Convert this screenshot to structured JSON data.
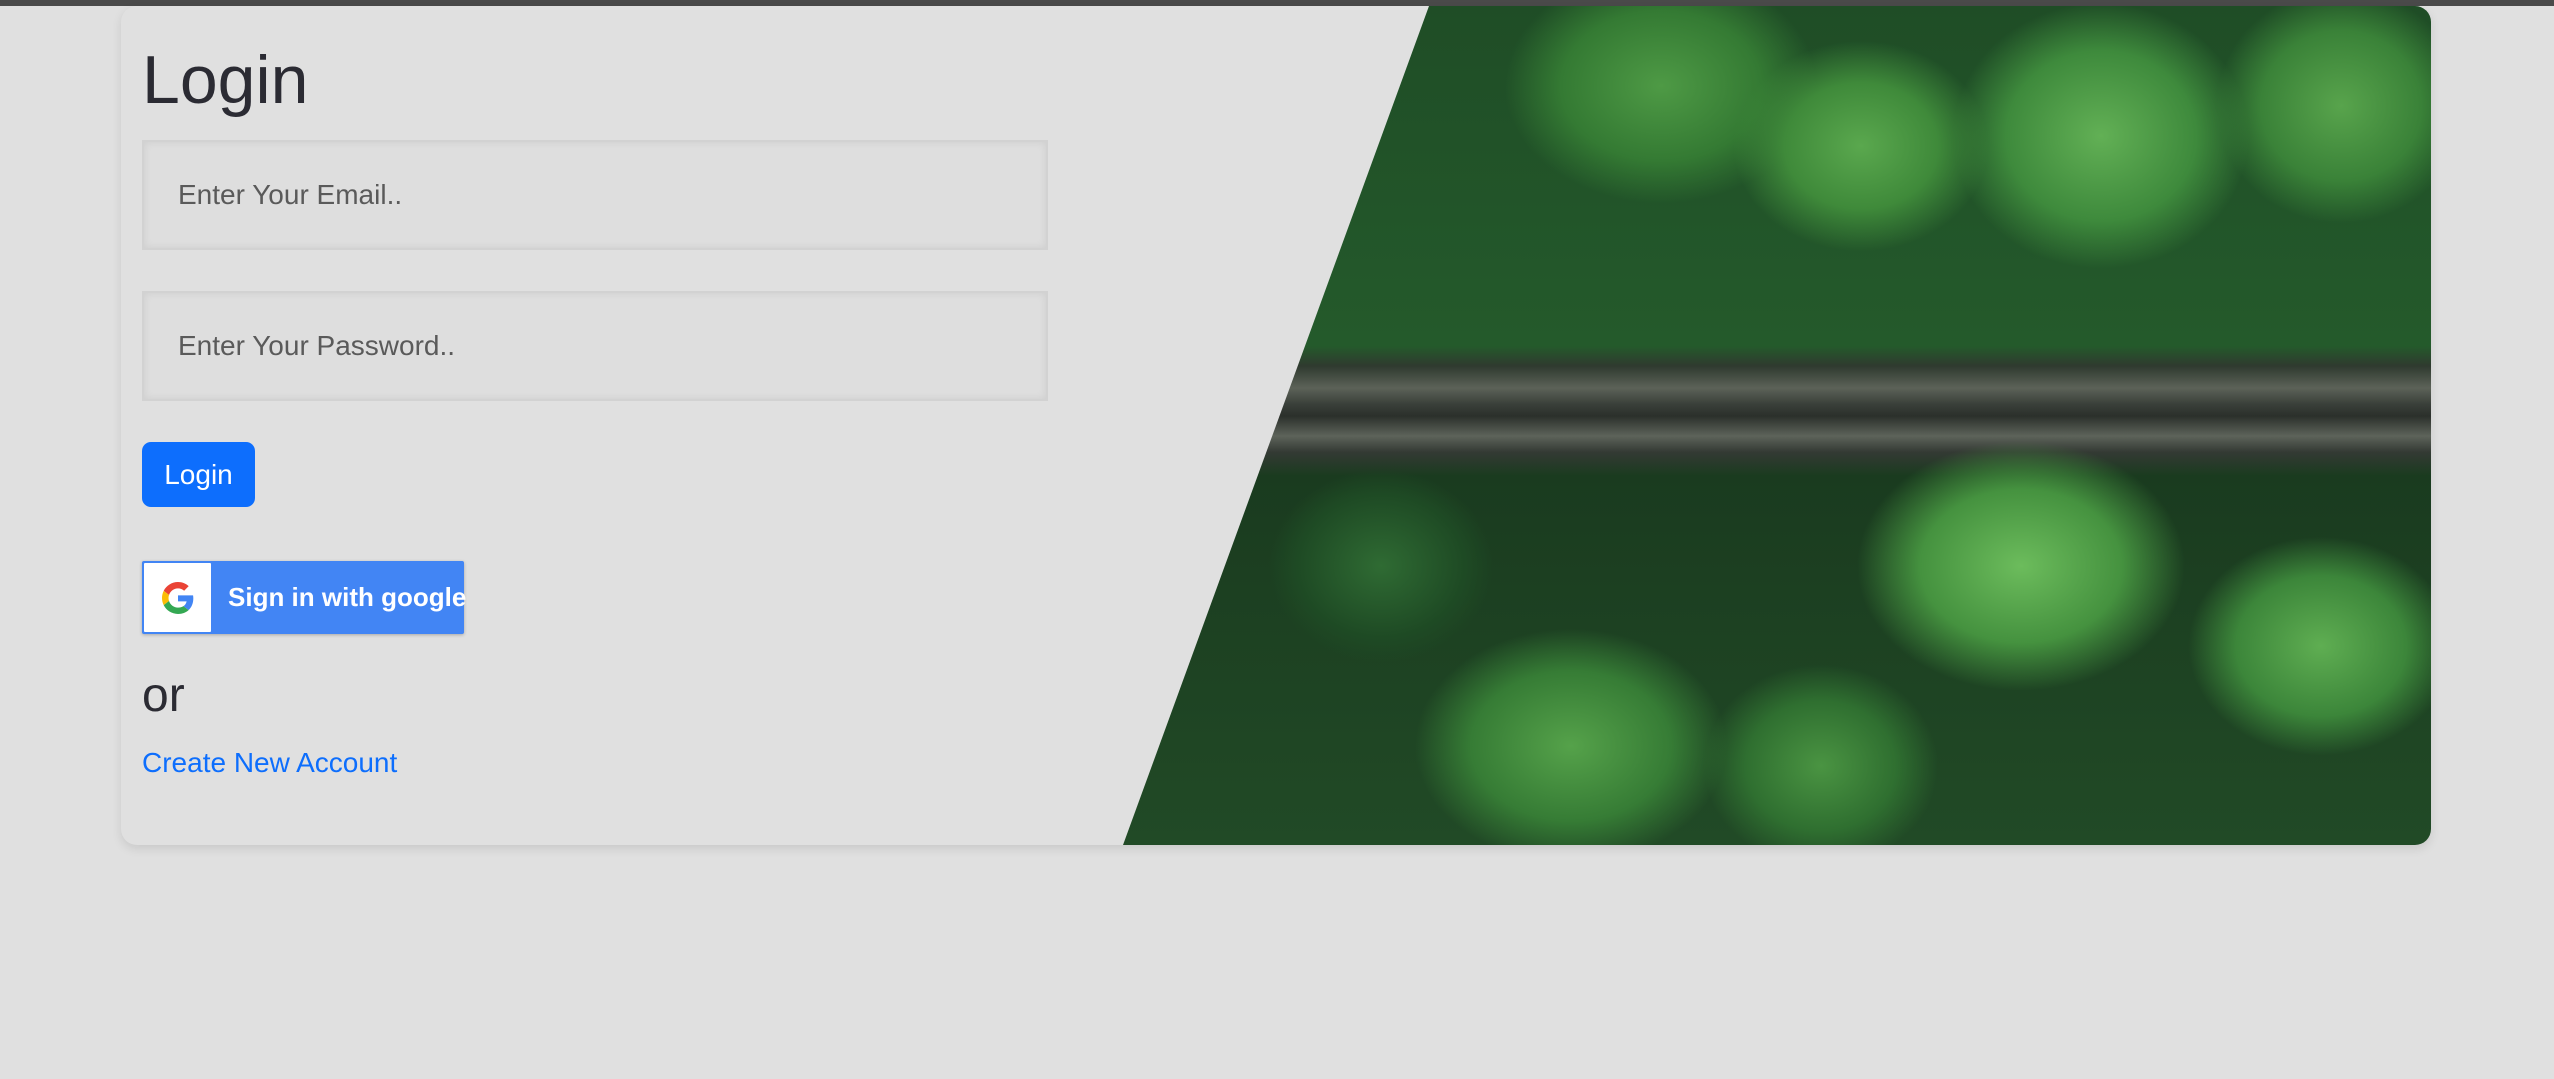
{
  "login": {
    "title": "Login",
    "email_placeholder": "Enter Your Email..",
    "password_placeholder": "Enter Your Password..",
    "login_button_label": "Login",
    "google_button_label": "Sign in with google",
    "or_text": "or",
    "create_account_link": "Create New Account"
  },
  "image": {
    "description_icon": "forest-road-aerial-photo"
  },
  "colors": {
    "primary": "#0d6efd",
    "google_blue": "#4285f4",
    "background": "#e0e0e0",
    "text_dark": "#2b2b33"
  }
}
